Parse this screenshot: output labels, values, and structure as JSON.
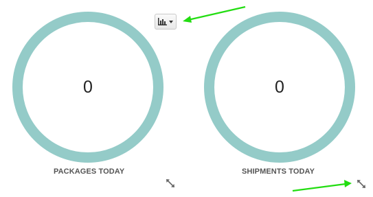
{
  "widgets": [
    {
      "value": "0",
      "label": "PACKAGES TODAY",
      "icon": "expand-icon"
    },
    {
      "value": "0",
      "label": "SHIPMENTS TODAY",
      "icon": "expand-icon"
    }
  ],
  "toolbar": {
    "chart_toggle_icon": "bar-chart-icon",
    "dropdown_icon": "caret-down-icon"
  },
  "colors": {
    "ring": "#94cbc8",
    "annotation": "#22dd11",
    "label": "#555555"
  }
}
